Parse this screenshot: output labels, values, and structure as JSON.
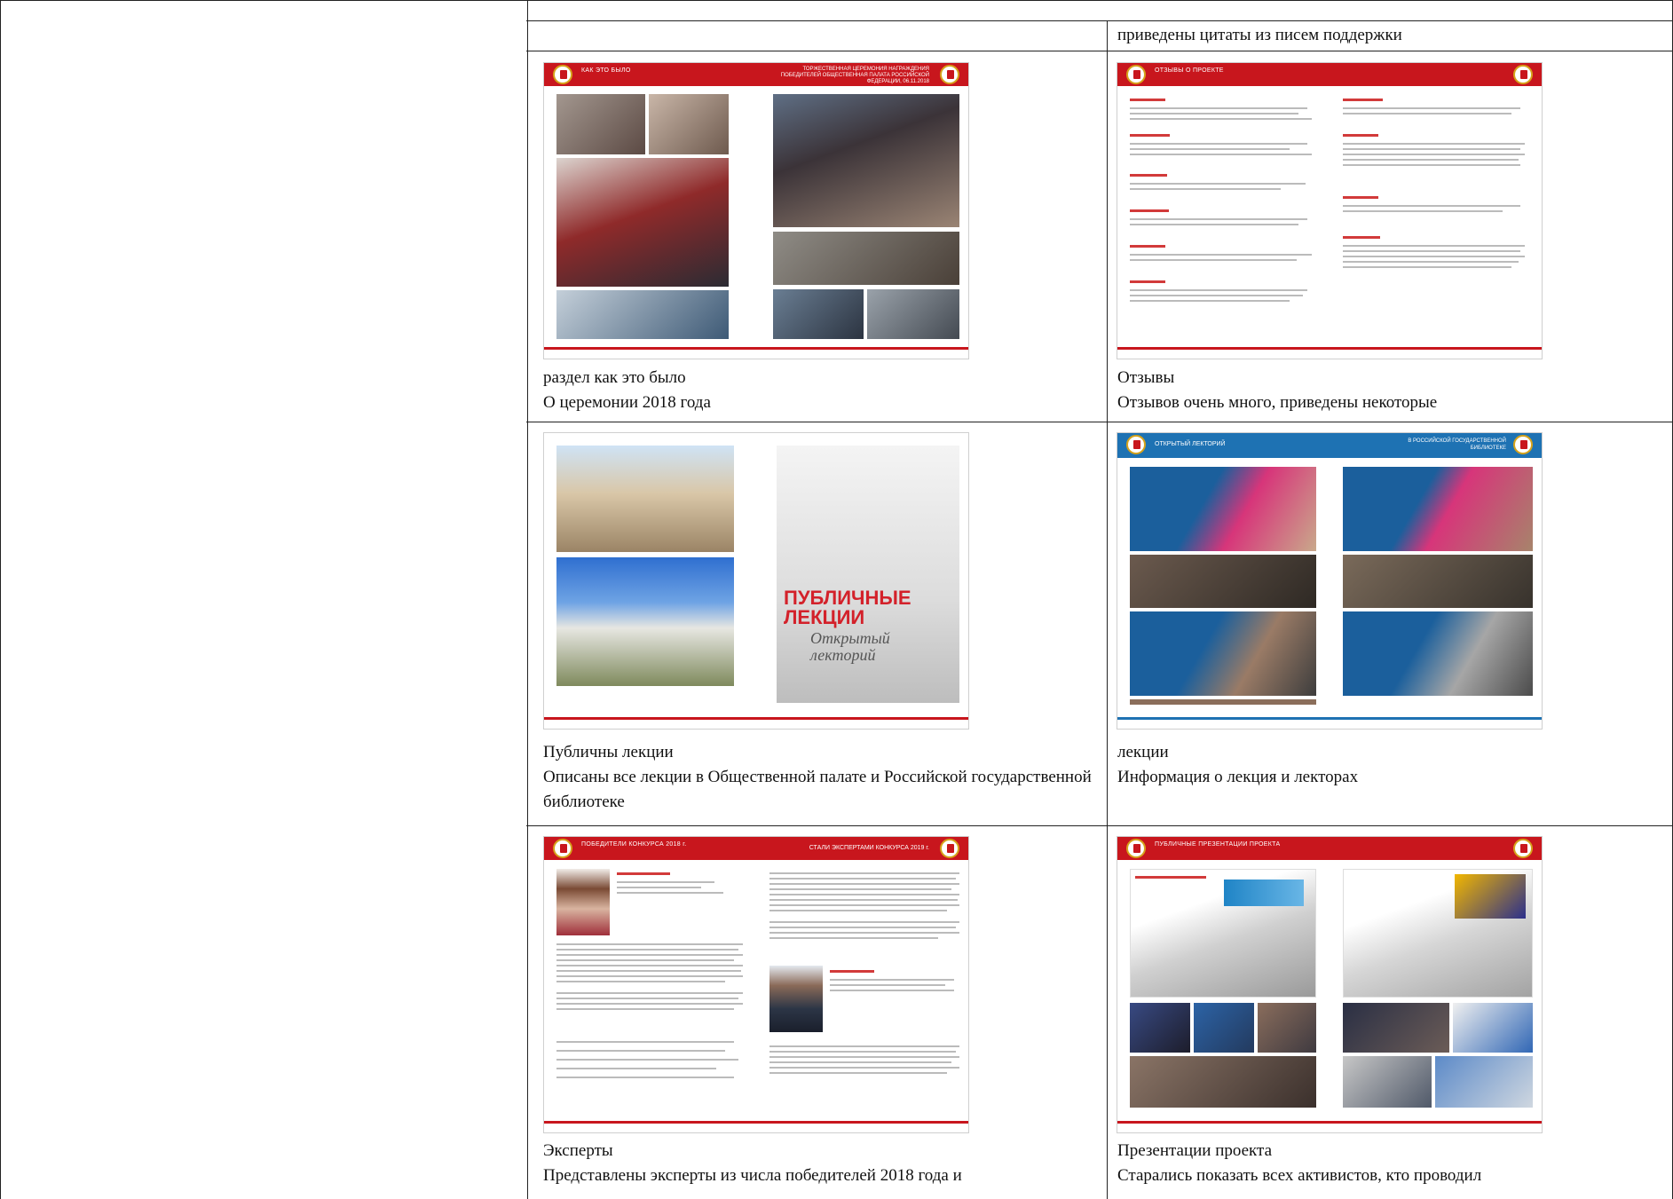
{
  "top_right_cell": {
    "text": "приведены цитаты из писем поддержки"
  },
  "cells": [
    {
      "title": "раздел как это было",
      "desc": "О церемонии 2018 года",
      "thumb": {
        "header_left": "КАК ЭТО БЫЛО",
        "header_right": "ТОРЖЕСТВЕННАЯ ЦЕРЕМОНИЯ НАГРАЖДЕНИЯ ПОБЕДИТЕЛЕЙ ОБЩЕСТВЕННАЯ ПАЛАТА РОССИЙСКОЙ ФЕДЕРАЦИИ, 06.11.2018"
      }
    },
    {
      "title": "Отзывы",
      "desc": "Отзывов очень много, приведены некоторые",
      "thumb": {
        "header_left": "ОТЗЫВЫ О ПРОЕКТЕ"
      }
    },
    {
      "title": "Публичны лекции",
      "desc": "Описаны все лекции в Общественной палате и Российской государственной библиотеке",
      "thumb": {
        "poster_title": "ПУБЛИЧНЫЕ ЛЕКЦИИ",
        "poster_subtitle": "Открытый лекторий"
      }
    },
    {
      "title": "лекции",
      "desc": "Информация о лекция и лекторах",
      "thumb": {
        "header_left": "ОТКРЫТЫЙ ЛЕКТОРИЙ",
        "header_right": "В РОССИЙСКОЙ ГОСУДАРСТВЕННОЙ БИБЛИОТЕКЕ"
      }
    },
    {
      "title": "Эксперты",
      "desc": "Представлены эксперты из числа победителей 2018 года и",
      "thumb": {
        "header_left": "ПОБЕДИТЕЛИ КОНКУРСА 2018 г.",
        "header_right": "СТАЛИ ЭКСПЕРТАМИ КОНКУРСА 2019 г."
      }
    },
    {
      "title": "Презентации проекта",
      "desc": "Старались показать всех активистов, кто проводил",
      "thumb": {
        "header_left": "ПУБЛИЧНЫЕ ПРЕЗЕНТАЦИИ ПРОЕКТА"
      }
    }
  ]
}
